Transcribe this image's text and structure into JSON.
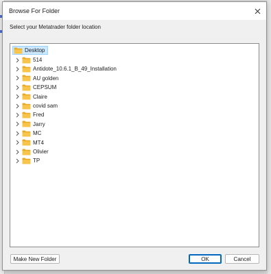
{
  "dialog": {
    "title": "Browse For Folder",
    "prompt": "Select your Metatrader folder location",
    "close_icon": "close-icon"
  },
  "tree": {
    "root": {
      "label": "Desktop",
      "icon": "folder-icon",
      "selected": true
    },
    "children": [
      {
        "label": "514",
        "icon": "folder-icon"
      },
      {
        "label": "Antidote_10.6.1_B_49_Installation",
        "icon": "folder-icon"
      },
      {
        "label": "AU golden",
        "icon": "folder-icon"
      },
      {
        "label": "CEPSUM",
        "icon": "folder-icon"
      },
      {
        "label": "Claire",
        "icon": "folder-icon"
      },
      {
        "label": "covid sam",
        "icon": "folder-icon"
      },
      {
        "label": "Fred",
        "icon": "folder-icon"
      },
      {
        "label": "Jarry",
        "icon": "folder-icon"
      },
      {
        "label": "MC",
        "icon": "folder-icon"
      },
      {
        "label": "MT4",
        "icon": "folder-icon"
      },
      {
        "label": "Olivier",
        "icon": "folder-icon"
      },
      {
        "label": "TP",
        "icon": "folder-icon"
      }
    ]
  },
  "buttons": {
    "make_new_folder": "Make New Folder",
    "ok": "OK",
    "cancel": "Cancel"
  },
  "colors": {
    "folder_fill": "#f8c54c",
    "folder_dark": "#e6a928",
    "selection_bg": "#cce8ff",
    "default_button_border": "#0067c0"
  }
}
